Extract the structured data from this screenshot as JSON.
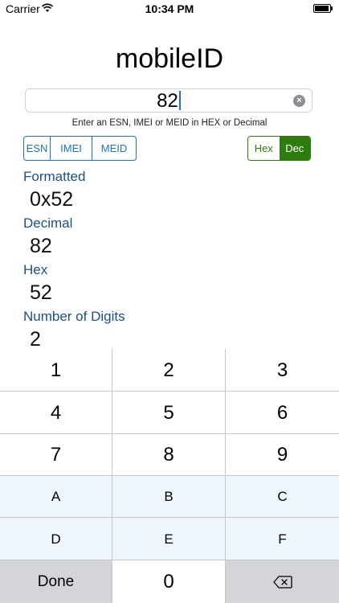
{
  "status_bar": {
    "carrier": "Carrier",
    "time": "10:34 PM"
  },
  "app": {
    "title": "mobileID"
  },
  "input": {
    "value": "82",
    "hint": "Enter an ESN, IMEI or MEID in HEX or Decimal"
  },
  "type_segment": [
    "ESN",
    "IMEI",
    "MEID"
  ],
  "base_segment": {
    "hex": "Hex",
    "dec": "Dec",
    "selected": "Dec"
  },
  "results": {
    "formatted_label": "Formatted",
    "formatted_value": "0x52",
    "decimal_label": "Decimal",
    "decimal_value": "82",
    "hex_label": "Hex",
    "hex_value": "52",
    "digits_label": "Number of Digits",
    "digits_value": "2"
  },
  "keyboard": {
    "keys": [
      "1",
      "2",
      "3",
      "4",
      "5",
      "6",
      "7",
      "8",
      "9",
      "A",
      "B",
      "C",
      "D",
      "E",
      "F"
    ],
    "done": "Done",
    "zero": "0",
    "backspace_icon": "backspace-icon"
  },
  "colors": {
    "accent_blue": "#1a73c7",
    "accent_green": "#2e7b0f",
    "label_blue": "#1c4f8a"
  }
}
